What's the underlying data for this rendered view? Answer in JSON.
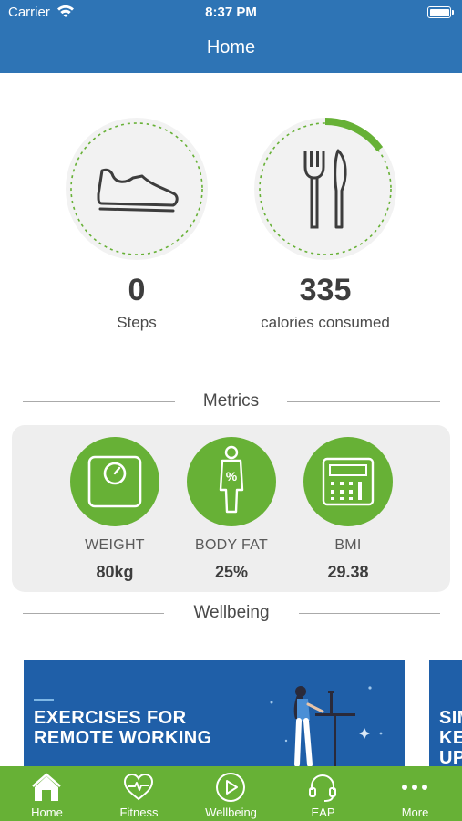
{
  "status_bar": {
    "carrier": "Carrier",
    "time": "8:37 PM"
  },
  "nav": {
    "title": "Home"
  },
  "stats": {
    "steps": {
      "value": "0",
      "label": "Steps",
      "progress": 0
    },
    "calories": {
      "value": "335",
      "label": "calories consumed",
      "progress": 0.15
    }
  },
  "sections": {
    "metrics": "Metrics",
    "wellbeing": "Wellbeing"
  },
  "metrics": [
    {
      "label": "WEIGHT",
      "value": "80kg",
      "icon": "scale-icon"
    },
    {
      "label": "BODY FAT",
      "value": "25%",
      "icon": "body-fat-icon"
    },
    {
      "label": "BMI",
      "value": "29.38",
      "icon": "calculator-icon"
    }
  ],
  "wellbeing_cards": [
    {
      "title": "EXERCISES FOR\nREMOTE WORKING"
    },
    {
      "title": "SIM\nKE\nUP"
    }
  ],
  "tabs": [
    {
      "label": "Home",
      "icon": "home-icon",
      "active": true
    },
    {
      "label": "Fitness",
      "icon": "heart-pulse-icon",
      "active": false
    },
    {
      "label": "Wellbeing",
      "icon": "play-circle-icon",
      "active": false
    },
    {
      "label": "EAP",
      "icon": "headset-icon",
      "active": false
    },
    {
      "label": "More",
      "icon": "more-dots-icon",
      "active": false
    }
  ],
  "colors": {
    "header": "#2e74b5",
    "accent_green": "#67b136",
    "banner_blue": "#1f5fa8"
  }
}
